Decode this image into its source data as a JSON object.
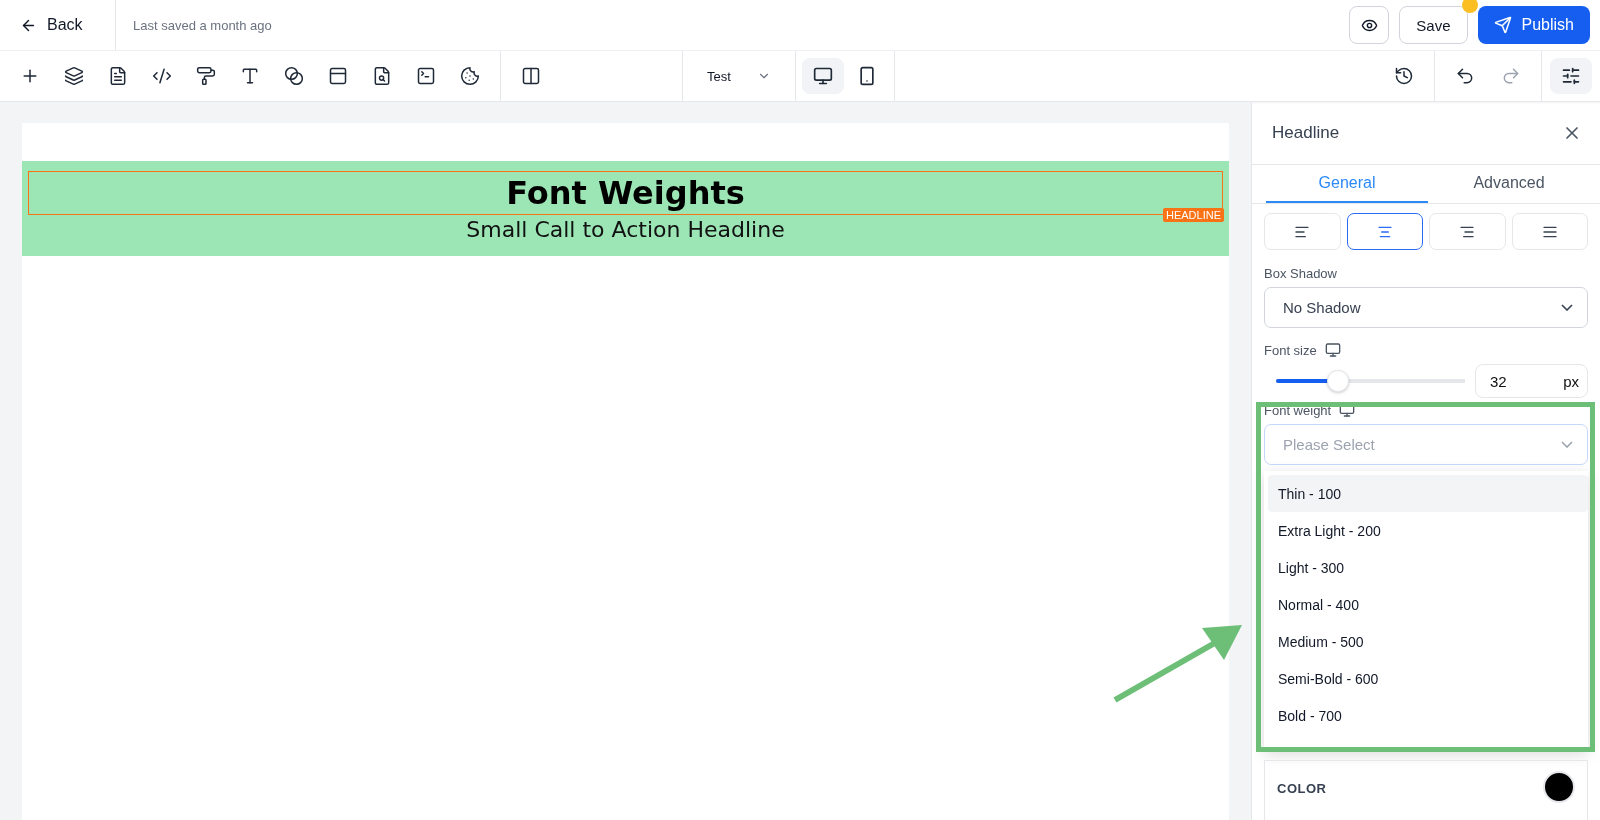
{
  "topbar": {
    "back": "Back",
    "saved_status": "Last saved a month ago",
    "save": "Save",
    "unsaved_dot": true,
    "publish": "Publish"
  },
  "toolbar": {
    "page_select": "Test",
    "devices": [
      {
        "kind": "desktop",
        "selected": true
      },
      {
        "kind": "mobile",
        "selected": false
      }
    ],
    "history": [
      {
        "kind": "undo",
        "disabled": false
      },
      {
        "kind": "redo",
        "disabled": true
      }
    ]
  },
  "canvas": {
    "title": "Font Weights",
    "subtitle": "Small Call to Action Headline",
    "badge": "HEADLINE"
  },
  "panel": {
    "title": "Headline",
    "tabs": [
      {
        "label": "General",
        "selected": true
      },
      {
        "label": "Advanced",
        "selected": false
      }
    ],
    "alignments": [
      {
        "kind": "left",
        "selected": false
      },
      {
        "kind": "center",
        "selected": true
      },
      {
        "kind": "right",
        "selected": false
      },
      {
        "kind": "justify",
        "selected": false
      }
    ],
    "box_shadow": {
      "label": "Box Shadow",
      "value": "No Shadow"
    },
    "font_size": {
      "label": "Font size",
      "level": 0.33,
      "value": "32",
      "unit": "px"
    },
    "font_weight": {
      "label": "Font weight",
      "placeholder": "Please Select",
      "options": [
        {
          "label": "Thin - 100",
          "selected": true
        },
        {
          "label": "Extra Light - 200",
          "selected": false
        },
        {
          "label": "Light - 300",
          "selected": false
        },
        {
          "label": "Normal - 400",
          "selected": false
        },
        {
          "label": "Medium - 500",
          "selected": false
        },
        {
          "label": "Semi-Bold - 600",
          "selected": false
        },
        {
          "label": "Bold - 700",
          "selected": false
        }
      ]
    },
    "color": {
      "label": "COLOR",
      "color": "#000000"
    }
  }
}
